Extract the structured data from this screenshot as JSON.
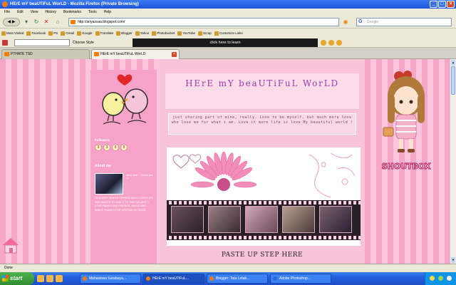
{
  "window": {
    "title": "HErE mY beaUTiFuL WorLD - Mozilla Firefox (Private Browsing)"
  },
  "menu": [
    "File",
    "Edit",
    "View",
    "History",
    "Bookmarks",
    "Tools",
    "Help"
  ],
  "nav": {
    "url": "http://ariyazsaa.blogspot.com/",
    "search_placeholder": "Google"
  },
  "bookmarks": [
    "Most Visited",
    "Facebook",
    "PS",
    "Gmail",
    "Google",
    "Translate",
    "Blogger",
    "Yahoo",
    "Photobucket",
    "YouTube",
    "Scrap",
    "Customize Links"
  ],
  "toolbar2": {
    "choose_label": "Choose Style",
    "banner_text": "click here to learn"
  },
  "tabs": [
    {
      "label": "PTHATE TSD"
    },
    {
      "label": "HErE mY beaUTiFuL WorLD"
    }
  ],
  "sidebar": {
    "visitor_label": "Followers",
    "counter_digits": [
      "3",
      "3",
      "0",
      "0"
    ],
    "about_title": "About me",
    "profile_side": "miss bee ~ lovely me ^^",
    "profile_text": "I'M A VERY SIMPLE PERSON WHO LOVES LIFE AND WANTS TO LIVE IT TO THE FULLEST. I LOVE FAMILY AND FRIENDS, MUSIC AND SMILE. THANKS FOR VISITING MY BLOG."
  },
  "main": {
    "site_title": "HErE mY beaUTiFuL WorLD",
    "description": "just sharing part of mine, really. Love to be myself, but much more love who love me for what i am. Love it more life is love My beautiful world !",
    "post_title": "PASTE UP STEP HERE"
  },
  "shoutbox_label": "SHOUTBOX",
  "statusbar": {
    "text": "Done"
  },
  "taskbar": {
    "start": "start",
    "tasks": [
      "Mahasiswa Surabaya...",
      "HErE mY beaUTiFuL...",
      "Blogger: Tata Letak...",
      "Adobe Photoshop..."
    ]
  },
  "colors": {
    "stripe_a": "#f6a6c9",
    "stripe_b": "#fbc6dd",
    "title_purple": "#9a3bb0",
    "sidebar_pink": "#f7a2c8"
  }
}
